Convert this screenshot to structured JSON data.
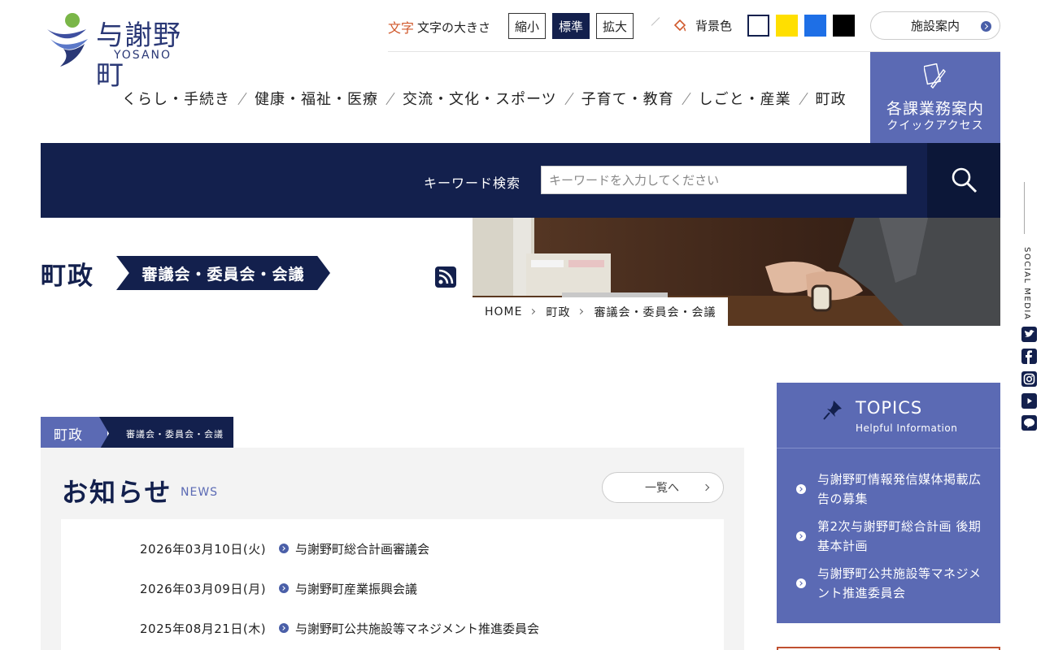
{
  "header": {
    "logo_name": "与謝野町",
    "logo_sub": "YOSANO",
    "font_size_label": "文字の大きさ",
    "font_size_icon": "文字",
    "font_sizes": [
      "縮小",
      "標準",
      "拡大"
    ],
    "active_font_size": "標準",
    "bg_color_label": "背景色",
    "bg_colors": [
      "#ffffff",
      "#ffdf00",
      "#1e6fe6",
      "#000000"
    ],
    "facility_label": "施設案内"
  },
  "nav": {
    "items": [
      "くらし・手続き",
      "健康・福祉・医療",
      "交流・文化・スポーツ",
      "子育て・教育",
      "しごと・産業",
      "町政"
    ]
  },
  "quick": {
    "title": "各課業務案内",
    "sub": "クイックアクセス"
  },
  "search": {
    "label": "キーワード検索",
    "placeholder": "キーワードを入力してください"
  },
  "page": {
    "title": "町政",
    "category": "審議会・委員会・会議"
  },
  "breadcrumb": [
    "HOME",
    "町政",
    "審議会・委員会・会議"
  ],
  "social": {
    "label": "SOCIAL MEDIA",
    "icons": [
      "twitter-icon",
      "facebook-icon",
      "instagram-icon",
      "youtube-icon",
      "line-icon"
    ]
  },
  "tabs": {
    "primary": "町政",
    "secondary": "審議会・委員会・会議"
  },
  "news": {
    "title": "お知らせ",
    "sub": "NEWS",
    "more_label": "一覧へ",
    "items": [
      {
        "date": "2026年03月10日(火)",
        "title": "与謝野町総合計画審議会"
      },
      {
        "date": "2026年03月09日(月)",
        "title": "与謝野町産業振興会議"
      },
      {
        "date": "2025年08月21日(木)",
        "title": "与謝野町公共施設等マネジメント推進委員会"
      }
    ]
  },
  "topics": {
    "title": "TOPICS",
    "sub": "Helpful Information",
    "items": [
      "与謝野町情報発信媒体掲載広告の募集",
      "第2次与謝野町総合計画 後期基本計画",
      "与謝野町公共施設等マネジメント推進委員会"
    ]
  },
  "colors": {
    "navy": "#13204d",
    "accent": "#5b6ab4",
    "logo_green": "#7ab648"
  }
}
